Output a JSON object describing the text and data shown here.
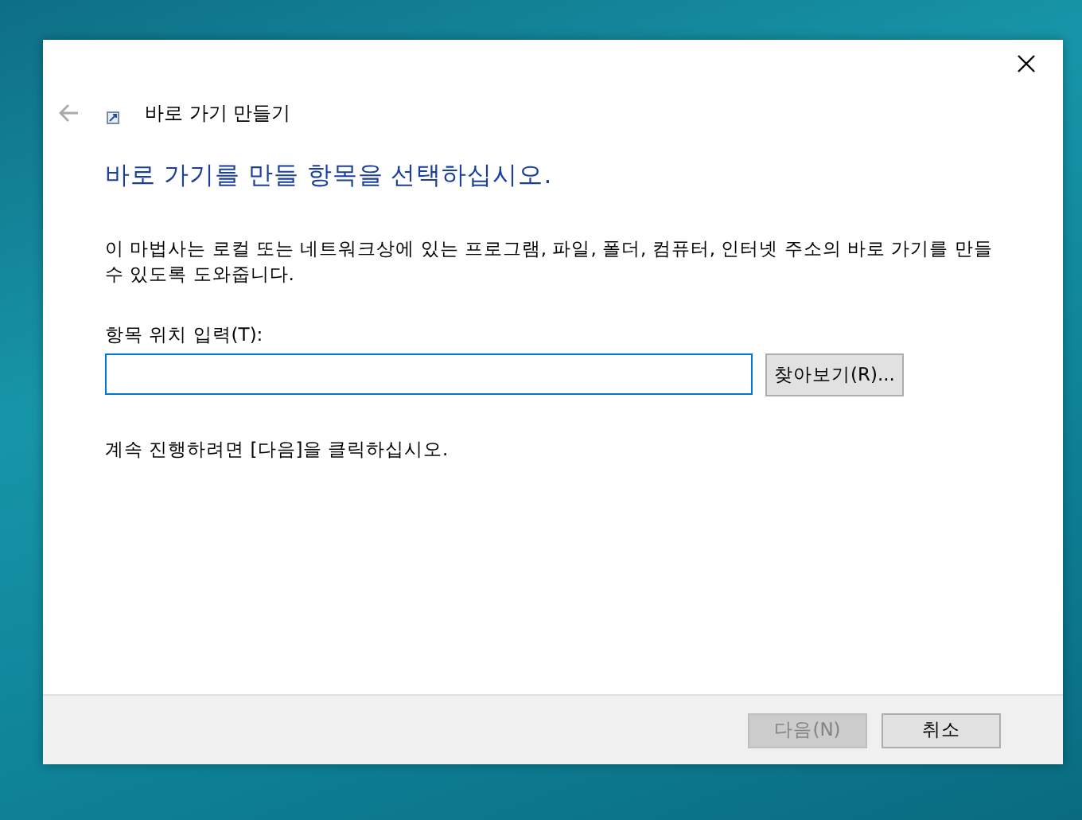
{
  "window": {
    "title": "바로 가기 만들기"
  },
  "heading": "바로 가기를 만들 항목을 선택하십시오.",
  "description": "이 마법사는 로컬 또는 네트워크상에 있는 프로그램, 파일, 폴더, 컴퓨터, 인터넷 주소의 바로 가기를 만들 수 있도록 도와줍니다.",
  "location_field": {
    "label": "항목 위치 입력(T):",
    "browse_button": "찾아보기(R)..."
  },
  "instruction": "계속 진행하려면 [다음]을 클릭하십시오.",
  "buttons": [
    {
      "label": "다음(N)",
      "disabled": true
    },
    {
      "label": "취소",
      "disabled": false
    }
  ]
}
